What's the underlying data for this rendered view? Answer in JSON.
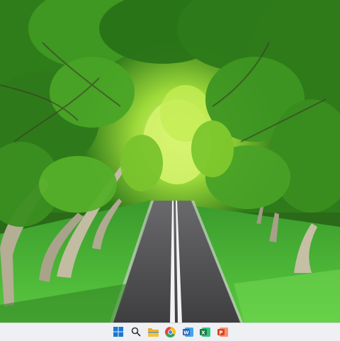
{
  "desktop": {
    "wallpaper": "tree-lined road",
    "colors": {
      "sky": "#d8f27a",
      "canopy_dark": "#1f5a14",
      "canopy_mid": "#3f9a22",
      "canopy_light": "#8ed12e",
      "grass": "#4dbb3c",
      "road": "#4a4a4c",
      "road_line": "#f2f2f2",
      "trunk": "#b9b39b"
    }
  },
  "taskbar": {
    "background": "#eef0f3",
    "icons": [
      {
        "name": "start-icon",
        "color": "#1a78d6"
      },
      {
        "name": "search-icon",
        "color": "#333333"
      },
      {
        "name": "file-explorer-icon",
        "color": "#f3c13a"
      },
      {
        "name": "chrome-icon",
        "color": "#e94235"
      },
      {
        "name": "word-icon",
        "color": "#2b5fb2",
        "glyph": "W"
      },
      {
        "name": "excel-icon",
        "color": "#1f7a45",
        "glyph": "X"
      },
      {
        "name": "powerpoint-icon",
        "color": "#d24726",
        "glyph": "P"
      }
    ]
  }
}
